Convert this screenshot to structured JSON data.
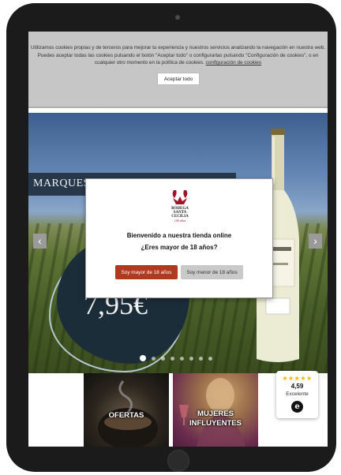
{
  "cookie_banner": {
    "text": "Utilizamos cookies propias y de terceros para mejorar tu experiencia y nuestros servicios analizando la navegación en nuestra web. Puedes aceptar todas las cookies pulsando el botón \"Aceptar todo\" o configurarlas pulsando \"Configuración de cookies\", o en cualquier otro momento en la política de cookies.",
    "config_link": "configuración de cookies",
    "accept_label": "Aceptar todo"
  },
  "hero": {
    "banner_text": "MARQUES",
    "price": "7,95€",
    "slide_count": 8,
    "active_slide": 1,
    "prev_icon": "chevron-left-icon",
    "next_icon": "chevron-right-icon"
  },
  "age_modal": {
    "logo_text": [
      "BODEGA",
      "SANTA",
      "CECILIA",
      "100 años"
    ],
    "line1": "Bienvenido a nuestra tienda online",
    "line2": "¿Eres mayor de 18 años?",
    "yes_label": "Soy mayor de 18 años",
    "no_label": "Soy menor de 18 años"
  },
  "tiles": [
    {
      "label": "OFERTAS"
    },
    {
      "label": "MUJERES INFLUYENTES"
    }
  ],
  "rating": {
    "stars": "★★★★★",
    "score": "4,59",
    "verdict": "Excelente",
    "badge": "e"
  },
  "colors": {
    "primary_button": "#b03a1f",
    "secondary_button": "#c9c9c9",
    "cookie_bg": "#c6c6c6",
    "star": "#f5b400"
  }
}
